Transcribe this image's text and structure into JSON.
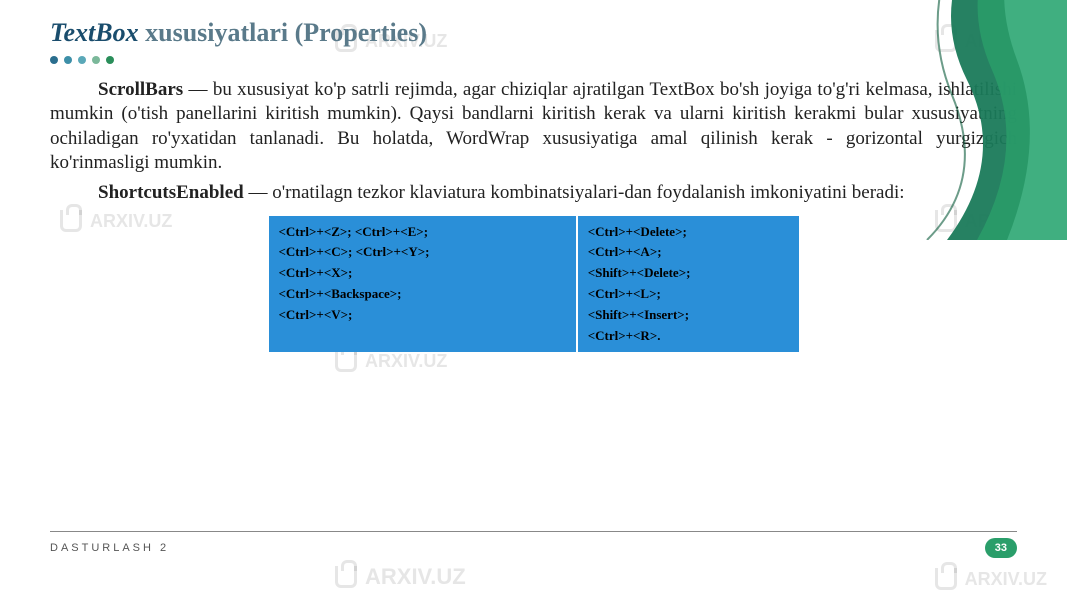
{
  "title_italic": "TextBox",
  "title_rest": " xususiyatlari (Properties)",
  "paragraph1_bold": "ScrollBars",
  "paragraph1_rest": " — bu xususiyat ko'p satrli rejimda, agar chiziqlar ajratilgan TextBox bo'sh joyiga to'g'ri kelmasa, ishlatilishi mumkin (o'tish panellarini kiritish  mumkin). Qaysi bandlarni kiritish kerak va ularni kiritish kerakmi bular xususiyatning ochiladigan ro'yxatidan tanlanadi. Bu holatda,  WordWrap xususiyatiga amal qilinish kerak - gorizontal yurgizgich ko'rinmasligi mumkin.",
  "paragraph2_bold": "ShortcutsEnabled",
  "paragraph2_rest": " — o'rnatilagn tezkor klaviatura kombinatsiyalari-dan foydalanish imkoniyatini beradi:",
  "shortcuts": {
    "col1": "<Ctrl>+<Z>;   <Ctrl>+<E>;\n<Ctrl>+<C>;   <Ctrl>+<Y>;\n<Ctrl>+<X>;\n<Ctrl>+<Backspace>;\n<Ctrl>+<V>;",
    "col2": " <Ctrl>+<Delete>;\n<Ctrl>+<A>;\n <Shift>+<Delete>;\n<Ctrl>+<L>;\n <Shift>+<Insert>;\n<Ctrl>+<R>."
  },
  "footer_text": "DASTURLASH 2",
  "page_number": "33",
  "watermark_text": "ARXIV.UZ",
  "colors": {
    "accent_green": "#2a9e6a",
    "title_blue": "#1a4d6d",
    "table_blue": "#2a8fd8"
  }
}
